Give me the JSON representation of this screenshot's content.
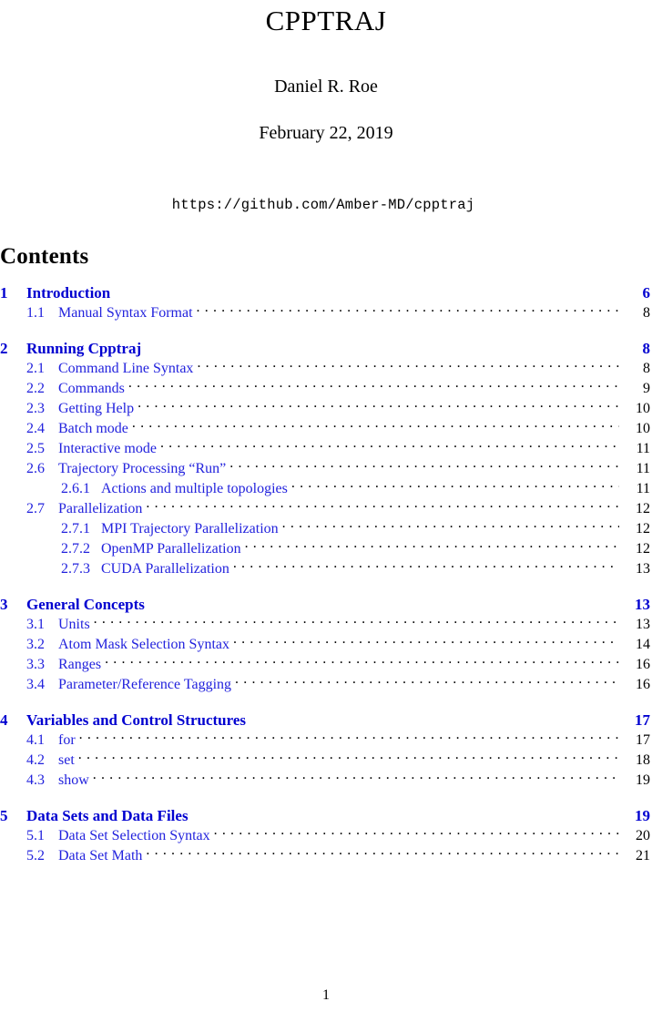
{
  "document": {
    "title": "CPPTRAJ",
    "author": "Daniel R. Roe",
    "date": "February 22, 2019",
    "url": "https://github.com/Amber-MD/cpptraj",
    "contents_heading": "Contents",
    "page_number": "1"
  },
  "colors": {
    "link_blue": "#2222dd",
    "section_blue": "#0000d0",
    "text_black": "#000000",
    "background": "#ffffff"
  },
  "toc": {
    "entries": [
      {
        "level": "section",
        "number": "1",
        "label": "Introduction",
        "page": "6"
      },
      {
        "level": "subsection",
        "number": "1.1",
        "label": "Manual Syntax Format",
        "page": "8"
      },
      {
        "level": "section",
        "number": "2",
        "label": "Running Cpptraj",
        "page": "8"
      },
      {
        "level": "subsection",
        "number": "2.1",
        "label": "Command Line Syntax",
        "page": "8"
      },
      {
        "level": "subsection",
        "number": "2.2",
        "label": "Commands",
        "page": "9"
      },
      {
        "level": "subsection",
        "number": "2.3",
        "label": "Getting Help",
        "page": "10"
      },
      {
        "level": "subsection",
        "number": "2.4",
        "label": "Batch mode",
        "page": "10"
      },
      {
        "level": "subsection",
        "number": "2.5",
        "label": "Interactive mode",
        "page": "11"
      },
      {
        "level": "subsection",
        "number": "2.6",
        "label": "Trajectory Processing “Run”",
        "page": "11"
      },
      {
        "level": "subsubsection",
        "number": "2.6.1",
        "label": "Actions and multiple topologies",
        "page": "11"
      },
      {
        "level": "subsection",
        "number": "2.7",
        "label": "Parallelization",
        "page": "12"
      },
      {
        "level": "subsubsection",
        "number": "2.7.1",
        "label": "MPI Trajectory Parallelization",
        "page": "12"
      },
      {
        "level": "subsubsection",
        "number": "2.7.2",
        "label": "OpenMP Parallelization",
        "page": "12"
      },
      {
        "level": "subsubsection",
        "number": "2.7.3",
        "label": "CUDA Parallelization",
        "page": "13"
      },
      {
        "level": "section",
        "number": "3",
        "label": "General Concepts",
        "page": "13"
      },
      {
        "level": "subsection",
        "number": "3.1",
        "label": "Units",
        "page": "13"
      },
      {
        "level": "subsection",
        "number": "3.2",
        "label": "Atom Mask Selection Syntax",
        "page": "14"
      },
      {
        "level": "subsection",
        "number": "3.3",
        "label": "Ranges",
        "page": "16"
      },
      {
        "level": "subsection",
        "number": "3.4",
        "label": "Parameter/Reference Tagging",
        "page": "16"
      },
      {
        "level": "section",
        "number": "4",
        "label": "Variables and Control Structures",
        "page": "17"
      },
      {
        "level": "subsection",
        "number": "4.1",
        "label": "for",
        "page": "17"
      },
      {
        "level": "subsection",
        "number": "4.2",
        "label": "set",
        "page": "18"
      },
      {
        "level": "subsection",
        "number": "4.3",
        "label": "show",
        "page": "19"
      },
      {
        "level": "section",
        "number": "5",
        "label": "Data Sets and Data Files",
        "page": "19"
      },
      {
        "level": "subsection",
        "number": "5.1",
        "label": "Data Set Selection Syntax",
        "page": "20"
      },
      {
        "level": "subsection",
        "number": "5.2",
        "label": "Data Set Math",
        "page": "21"
      }
    ]
  }
}
